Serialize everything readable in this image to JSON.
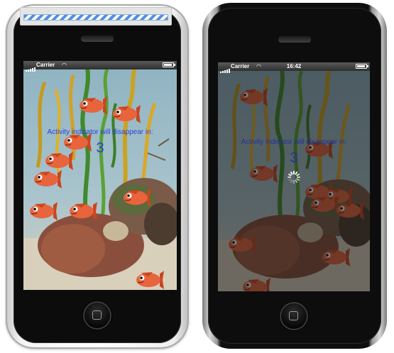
{
  "left_device": {
    "status_bar": {
      "carrier": "Carrier",
      "time": ""
    },
    "indicator_label": "Activity indicator will disappear in:",
    "countdown_value": "3",
    "activity_indicator_visible": false,
    "overlay_dimmed": false
  },
  "right_device": {
    "status_bar": {
      "carrier": "Carrier",
      "time": "16:42"
    },
    "indicator_label": "Activity indicator will disappear in:",
    "countdown_value": "3",
    "activity_indicator_visible": true,
    "overlay_dimmed": true
  },
  "colors": {
    "label_text": "#2a3fd6",
    "label_text_dimmed": "#233396",
    "fish_body": "#e8643c",
    "fish_dark": "#c8461f"
  },
  "icons": [
    "signal-strength-icon",
    "wifi-icon",
    "battery-icon",
    "home-square-icon",
    "activity-spinner-icon",
    "fish-icon"
  ]
}
